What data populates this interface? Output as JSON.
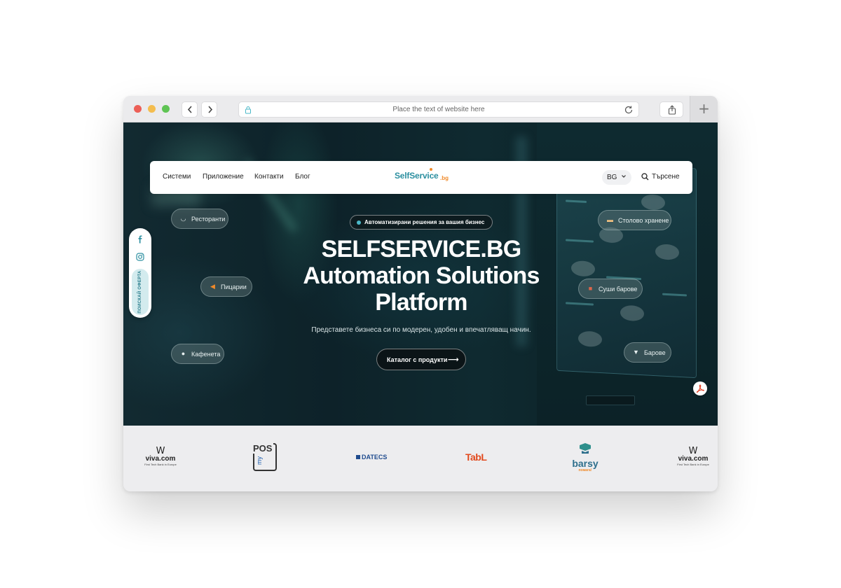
{
  "browser": {
    "url_placeholder": "Place the text of website here",
    "back_icon": "chevron-left-icon",
    "forward_icon": "chevron-right-icon",
    "lock_icon": "lock-icon",
    "reload_icon": "reload-icon",
    "share_icon": "share-icon",
    "new_tab_icon": "plus-icon",
    "new_tab_glyph": "+"
  },
  "nav": {
    "links": [
      "Системи",
      "Приложение",
      "Контакти",
      "Блог"
    ],
    "logo_main": "SelfService",
    "logo_tld": ".bg",
    "language": "BG",
    "search_label": "Търсене"
  },
  "social": {
    "items": [
      "facebook-icon",
      "instagram-icon"
    ],
    "offer_label": "ПОИСКАЙ ОФЕРТА"
  },
  "hero": {
    "badge": "Автоматизирани решения за вашия бизнес",
    "title_line1": "SELFSERVICE.BG",
    "title_line2": "Automation Solutions",
    "title_line3": "Platform",
    "subtitle": "Представете бизнеса си по модерен, удобен и впечатляващ начин.",
    "cta_label": "Каталог с продукти",
    "cta_arrow": "⟶"
  },
  "categories": [
    {
      "label": "Ресторанти",
      "icon": "cloche-icon",
      "glyph": "◡"
    },
    {
      "label": "Пицарии",
      "icon": "pizza-icon",
      "glyph": "◀"
    },
    {
      "label": "Кафенета",
      "icon": "coffee-icon",
      "glyph": "●"
    },
    {
      "label": "Столово хранене",
      "icon": "burger-icon",
      "glyph": "▬"
    },
    {
      "label": "Суши барове",
      "icon": "sushi-icon",
      "glyph": "■"
    },
    {
      "label": "Барове",
      "icon": "cocktail-icon",
      "glyph": "▼"
    }
  ],
  "partners": {
    "viva_main": "viva.com",
    "viva_sub": "First Tech Bank in Europe",
    "mypos_main": "POS",
    "mypos_my": "my",
    "datecs": "DATECS",
    "tabl": "TabL",
    "barsy": "barsy",
    "barsy_sub": "помага!"
  },
  "colors": {
    "brand": "#2c8fa0",
    "accent": "#f08a2a",
    "hero_bg": "#0f2a30",
    "badge_dot": "#4bb8c8"
  }
}
